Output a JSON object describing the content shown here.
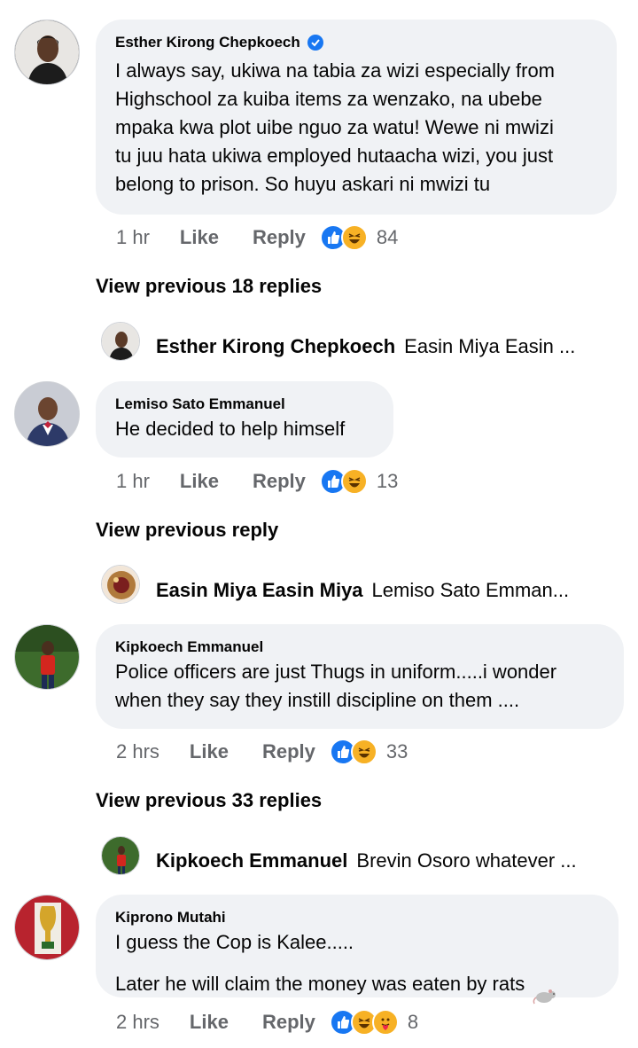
{
  "comments": [
    {
      "author": "Esther Kirong Chepkoech",
      "verified": true,
      "text": "I always say, ukiwa na tabia za wizi especially from\nHighschool za kuiba items za wenzako, na ubebe\nmpaka kwa plot uibe nguo za watu! Wewe ni mwizi\ntu juu hata ukiwa employed hutaacha wizi, you just\nbelong to prison. So huyu askari ni mwizi tu",
      "time": "1 hr",
      "like_label": "Like",
      "reply_label": "Reply",
      "reactions": [
        "like-icon",
        "haha-icon"
      ],
      "reaction_count": "84",
      "view_previous": "View previous 18 replies",
      "last_reply": {
        "author": "Esther Kirong Chepkoech",
        "preview": "Easin Miya Easin ..."
      }
    },
    {
      "author": "Lemiso Sato Emmanuel",
      "verified": false,
      "text": "He decided to help himself",
      "time": "1 hr",
      "like_label": "Like",
      "reply_label": "Reply",
      "reactions": [
        "like-icon",
        "haha-icon"
      ],
      "reaction_count": "13",
      "view_previous": "View previous reply",
      "last_reply": {
        "author": "Easin Miya Easin Miya",
        "preview": "Lemiso Sato Emman..."
      }
    },
    {
      "author": "Kipkoech Emmanuel",
      "verified": false,
      "text": "Police officers are just Thugs in uniform.....i wonder\nwhen they say they instill discipline on them ....",
      "time": "2 hrs",
      "like_label": "Like",
      "reply_label": "Reply",
      "reactions": [
        "like-icon",
        "haha-icon"
      ],
      "reaction_count": "33",
      "view_previous": "View previous 33 replies",
      "last_reply": {
        "author": "Kipkoech Emmanuel",
        "preview": "Brevin Osoro whatever ..."
      }
    },
    {
      "author": "Kiprono Mutahi",
      "verified": false,
      "text": "I guess the Cop is Kalee.....\nLater he will claim the money was eaten by rats",
      "emoji": "rat-emoji",
      "time": "2 hrs",
      "like_label": "Like",
      "reply_label": "Reply",
      "reactions": [
        "like-icon",
        "haha-icon",
        "care-icon"
      ],
      "reaction_count": "8"
    }
  ],
  "colors": {
    "link_blue": "#1877f2",
    "bubble_bg": "#f0f2f5",
    "meta_gray": "#65676b",
    "haha_yellow": "#f7b125"
  }
}
